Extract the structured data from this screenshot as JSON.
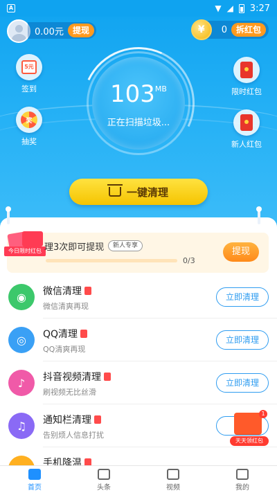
{
  "status": {
    "time": "3:27",
    "notif_icon": "A"
  },
  "header": {
    "balance": "0.00元",
    "withdraw_label": "提现",
    "coin_symbol": "¥",
    "coin_count": "0",
    "redbag_label": "拆红包"
  },
  "side": {
    "signin": {
      "label": "签到",
      "icon_text": "5元"
    },
    "lottery": {
      "label": "抽奖",
      "icon_text": "奖"
    },
    "limited": {
      "label": "限时红包"
    },
    "newuser": {
      "label": "新人红包"
    }
  },
  "gauge": {
    "value": "103",
    "unit": "MB",
    "status": "正在扫描垃圾..."
  },
  "clean_button": {
    "label": "一键清理"
  },
  "task": {
    "badge": "今日限时红包",
    "title": "理3次即可提现",
    "tag": "新人专享",
    "progress_text": "0/3",
    "progress": 0,
    "button": "提现"
  },
  "rows": [
    {
      "title": "微信清理",
      "sub": "微信清爽再现",
      "button": "立即清理",
      "color": "#3cc86b"
    },
    {
      "title": "QQ清理",
      "sub": "QQ清爽再现",
      "button": "立即清理",
      "color": "#3aa0f5"
    },
    {
      "title": "抖音视频清理",
      "sub": "刷视频无比丝滑",
      "button": "立即清理",
      "color": "#f05aa8"
    },
    {
      "title": "通知栏清理",
      "sub": "告别烦人信息打扰",
      "button": "立即",
      "color": "#8a6af5"
    },
    {
      "title": "手机降温",
      "sub": "",
      "button": "",
      "color": "#ffb020"
    }
  ],
  "promo": {
    "label": "天天领红包",
    "count": "1"
  },
  "nav": [
    {
      "label": "首页",
      "active": true
    },
    {
      "label": "头条",
      "active": false
    },
    {
      "label": "视频",
      "active": false
    },
    {
      "label": "我的",
      "active": false
    }
  ]
}
